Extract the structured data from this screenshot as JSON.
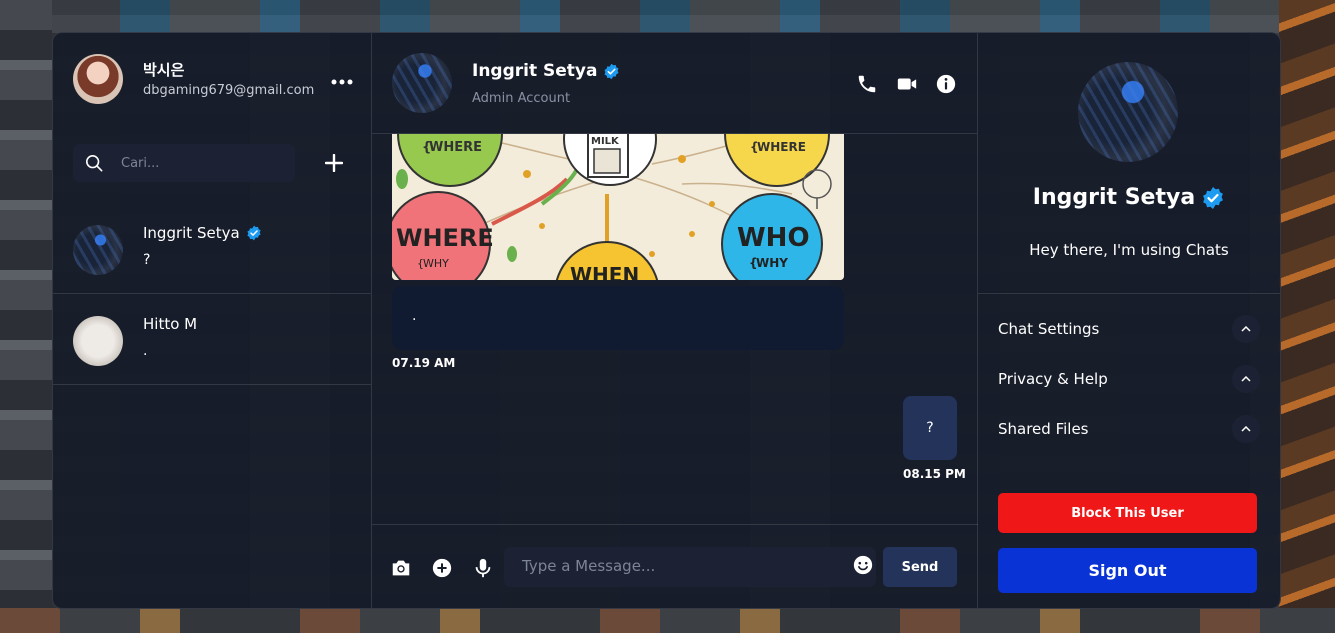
{
  "colors": {
    "panel_bg": "#171c2a",
    "bubble_in": "#101a30",
    "bubble_out": "#24335a",
    "verified_blue": "#1d9bf0",
    "block_red": "#ef1717",
    "signout_blue": "#0a33d6"
  },
  "sidebar": {
    "user_name": "박시은",
    "user_email": "dbgaming679@gmail.com",
    "search_placeholder": "Cari...",
    "contacts": [
      {
        "name": "Inggrit Setya",
        "last_message": "?",
        "verified": true
      },
      {
        "name": "Hitto M",
        "last_message": ".",
        "verified": false
      }
    ]
  },
  "chat": {
    "header": {
      "name": "Inggrit Setya",
      "subtitle": "Admin Account"
    },
    "image_labels": {
      "milk": "MILK",
      "where_small_left": "WHERE",
      "where_small_right": "WHERE",
      "where": "WHERE",
      "why_left": "WHY",
      "who": "WHO",
      "why_right": "WHY",
      "when": "WHEN"
    },
    "messages": [
      {
        "text": ".",
        "time": "07.19 AM",
        "direction": "in"
      },
      {
        "text": "?",
        "time": "08.15 PM",
        "direction": "out"
      }
    ],
    "composer": {
      "placeholder": "Type a Message...",
      "send_label": "Send"
    }
  },
  "profile": {
    "name": "Inggrit Setya",
    "status": "Hey there, I'm using Chats",
    "sections": [
      "Chat Settings",
      "Privacy & Help",
      "Shared Files"
    ],
    "block_label": "Block This User",
    "signout_label": "Sign Out"
  }
}
